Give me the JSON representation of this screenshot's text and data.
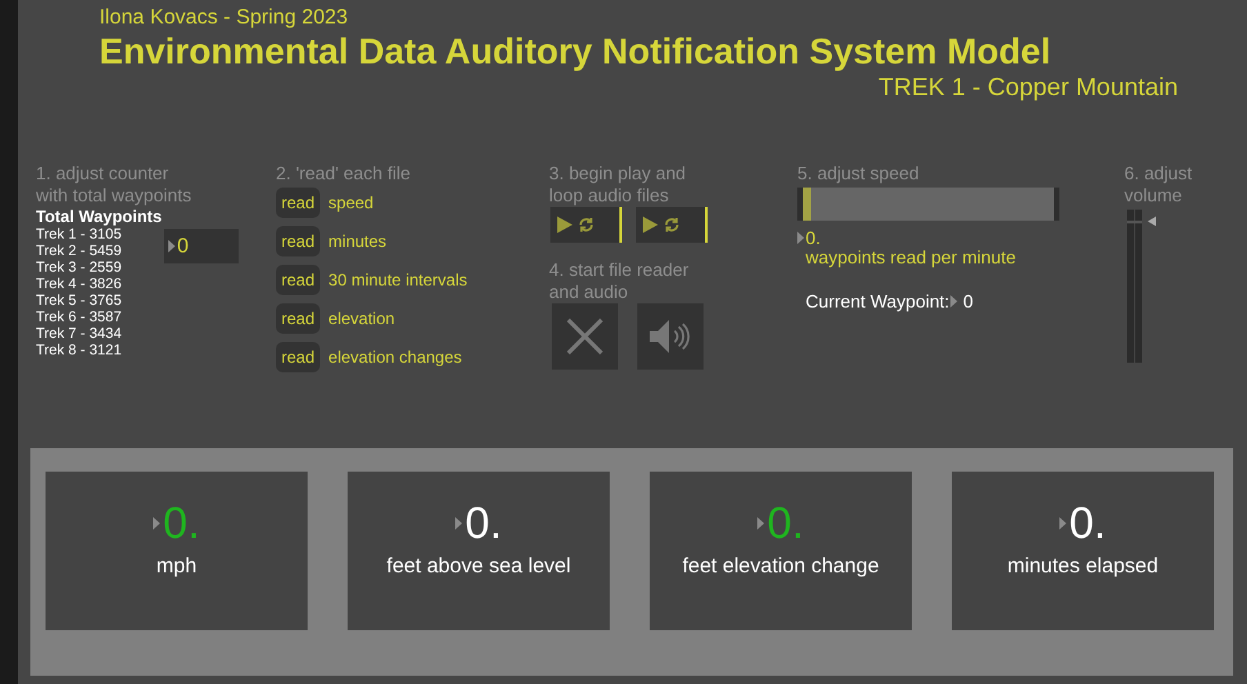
{
  "header": {
    "author": "Ilona Kovacs - Spring 2023",
    "title": "Environmental Data Auditory Notification System Model",
    "subtitle": "TREK 1 - Copper Mountain"
  },
  "counter": {
    "heading": "1. adjust counter with total waypoints",
    "list_title": "Total Waypoints",
    "treks": [
      "Trek 1 - 3105",
      "Trek 2 - 5459",
      "Trek 3 - 2559",
      "Trek 4 - 3826",
      "Trek 5 - 3765",
      "Trek 6 - 3587",
      "Trek 7 - 3434",
      "Trek 8 - 3121"
    ],
    "value": "0"
  },
  "files": {
    "heading": "2. 'read' each file",
    "items": [
      {
        "button": "read",
        "label": "speed"
      },
      {
        "button": "read",
        "label": "minutes"
      },
      {
        "button": "read",
        "label": "30 minute intervals"
      },
      {
        "button": "read",
        "label": "elevation"
      },
      {
        "button": "read",
        "label": "elevation changes"
      }
    ]
  },
  "play": {
    "heading": "3. begin play and loop audio files",
    "players": [
      {
        "playing": false
      },
      {
        "playing": false
      }
    ]
  },
  "start": {
    "heading": "4. start file reader and audio",
    "toggle_on": false,
    "audio_on": false
  },
  "speed": {
    "heading": "5. adjust speed",
    "level": 0,
    "value": "0.",
    "unit": "waypoints read per minute",
    "current_label": "Current Waypoint:",
    "current_value": "0"
  },
  "volume": {
    "heading": "6. adjust volume",
    "level": 0.93
  },
  "readouts": [
    {
      "value": "0.",
      "label": "mph",
      "color": "#1fb51f"
    },
    {
      "value": "0.",
      "label": "feet above sea level",
      "color": "#ffffff"
    },
    {
      "value": "0.",
      "label": "feet elevation change",
      "color": "#1fb51f"
    },
    {
      "value": "0.",
      "label": "minutes elapsed",
      "color": "#ffffff"
    }
  ]
}
